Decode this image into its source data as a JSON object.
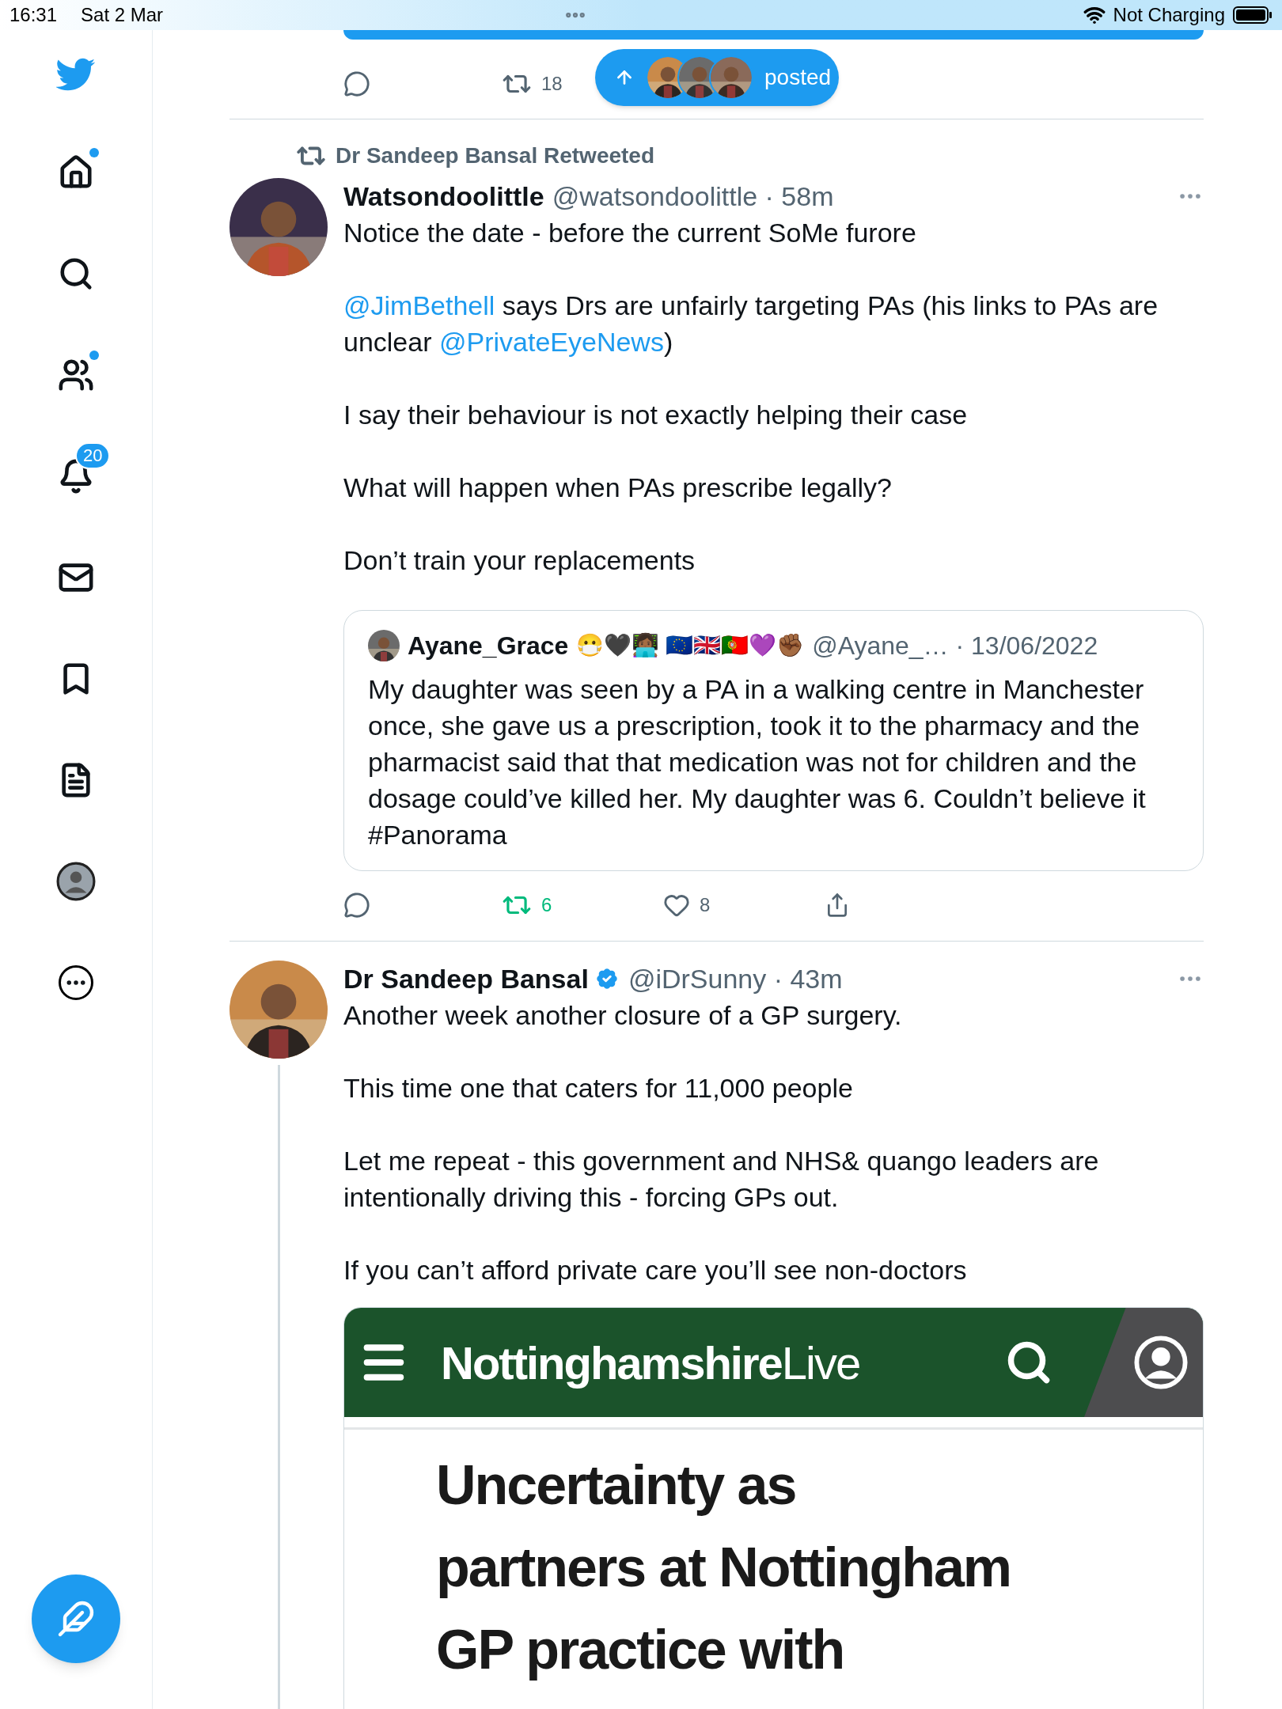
{
  "status_bar": {
    "time": "16:31",
    "date": "Sat 2 Mar",
    "battery_label": "Not Charging"
  },
  "sidebar": {
    "items": [
      {
        "kind": "bird"
      },
      {
        "kind": "home",
        "unread": true
      },
      {
        "kind": "search",
        "unread": false
      },
      {
        "kind": "communities",
        "unread": true
      },
      {
        "kind": "notifications",
        "unread": false,
        "badge": "20"
      },
      {
        "kind": "messages",
        "unread": false
      },
      {
        "kind": "bookmarks",
        "unread": false
      },
      {
        "kind": "lists",
        "unread": false
      },
      {
        "kind": "profile",
        "unread": false
      },
      {
        "kind": "more",
        "unread": false
      }
    ]
  },
  "previous_tweet": {
    "retweets": "18"
  },
  "new_posts_pill": {
    "label": "posted"
  },
  "tweets": [
    {
      "retweeted_by": "Dr Sandeep Bansal Retweeted",
      "name": "Watsondoolittle",
      "verified": false,
      "handle_time": "@watsondoolittle · 58m",
      "thread": false,
      "body": [
        [
          {
            "kind": "text",
            "text": "Notice the date - before the current SoMe furore"
          }
        ],
        [
          {
            "kind": "mention",
            "text": "@JimBethell"
          },
          {
            "kind": "text",
            "text": " says Drs are unfairly targeting PAs (his links to PAs are unclear "
          },
          {
            "kind": "mention",
            "text": "@PrivateEyeNews"
          },
          {
            "kind": "text",
            "text": ")"
          }
        ],
        [
          {
            "kind": "text",
            "text": "I say their behaviour is not exactly helping their case"
          }
        ],
        [
          {
            "kind": "text",
            "text": "What will happen when PAs prescribe legally?"
          }
        ],
        [
          {
            "kind": "text",
            "text": "Don’t train your replacements"
          }
        ]
      ],
      "quote": {
        "name": "Ayane_Grace",
        "name_emoji": "😷🖤👩🏾‍💻 🇪🇺🇬🇧🇵🇹💜✊🏾",
        "handle_time": "@Ayane_… · 13/06/2022",
        "text": "My daughter was seen by a PA in a walking centre in Manchester once, she gave us a prescription, took it to the pharmacy and the pharmacist said that that medication was not for children and the dosage could’ve killed her. My daughter was 6. Couldn’t believe it #Panorama"
      },
      "actions": {
        "retweets": "6",
        "retweeted": true,
        "likes": "8",
        "liked": false
      }
    },
    {
      "name": "Dr Sandeep Bansal",
      "verified": true,
      "handle_time": "@iDrSunny · 43m",
      "thread": true,
      "body": [
        [
          {
            "kind": "text",
            "text": "Another week another closure of a GP surgery."
          }
        ],
        [
          {
            "kind": "text",
            "text": "This time one that caters for 11,000 people"
          }
        ],
        [
          {
            "kind": "text",
            "text": "Let me repeat - this government and NHS& quango leaders are intentionally driving this - forcing GPs out."
          }
        ],
        [
          {
            "kind": "text",
            "text": "If you can’t afford private care you’ll see non-doctors"
          }
        ]
      ],
      "article": {
        "brand_main": "Nottinghamshire",
        "brand_suffix": "Live",
        "headline_lines": [
          "Uncertainty as",
          "partners at Nottingham",
          "GP practice with"
        ]
      }
    }
  ]
}
